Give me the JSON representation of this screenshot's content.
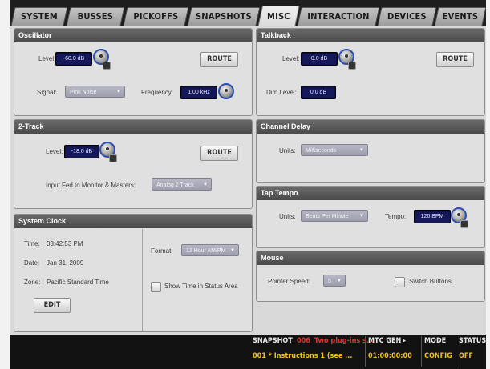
{
  "tabs": [
    {
      "label": "SYSTEM",
      "active": false
    },
    {
      "label": "BUSSES",
      "active": false
    },
    {
      "label": "PICKOFFS",
      "active": false
    },
    {
      "label": "SNAPSHOTS",
      "active": false
    },
    {
      "label": "MISC",
      "active": true
    },
    {
      "label": "INTERACTION",
      "active": false
    },
    {
      "label": "DEVICES",
      "active": false
    },
    {
      "label": "EVENTS",
      "active": false
    }
  ],
  "oscillator": {
    "title": "Oscillator",
    "level_label": "Level:",
    "level_value": "-60.0 dB",
    "route_label": "ROUTE",
    "signal_label": "Signal:",
    "signal_value": "Pink Noise",
    "frequency_label": "Frequency:",
    "frequency_value": "1.00 kHz"
  },
  "talkback": {
    "title": "Talkback",
    "level_label": "Level:",
    "level_value": "0.0 dB",
    "route_label": "ROUTE",
    "dim_label": "Dim Level:",
    "dim_value": "0.0 dB"
  },
  "two_track": {
    "title": "2-Track",
    "level_label": "Level:",
    "level_value": "-18.0 dB",
    "route_label": "ROUTE",
    "input_fed_label": "Input Fed to Monitor & Masters:",
    "input_fed_value": "Analog 2 Track"
  },
  "channel_delay": {
    "title": "Channel Delay",
    "units_label": "Units:",
    "units_value": "Milliseconds"
  },
  "tap_tempo": {
    "title": "Tap Tempo",
    "units_label": "Units:",
    "units_value": "Beats Per Minute",
    "tempo_label": "Tempo:",
    "tempo_value": "126 BPM"
  },
  "system_clock": {
    "title": "System Clock",
    "time_label": "Time:",
    "time_value": "03:42:53 PM",
    "date_label": "Date:",
    "date_value": "Jan 31, 2009",
    "zone_label": "Zone:",
    "zone_value": "Pacific Standard Time",
    "edit_label": "EDIT",
    "format_label": "Format:",
    "format_value": "12 Hour AM/PM",
    "show_time_label": "Show Time in Status Area"
  },
  "mouse": {
    "title": "Mouse",
    "pointer_speed_label": "Pointer Speed:",
    "pointer_speed_value": "5",
    "switch_buttons_label": "Switch Buttons"
  },
  "status": {
    "snapshot_label": "SNAPSHOT",
    "snapshot_num": "006",
    "snapshot_name": "Two plug-ins s...",
    "snapshot_line2": "001 * Instructions 1 (see ...",
    "mtc_label": "MTC GEN",
    "mtc_value": "01:00:00:00",
    "mode_label": "MODE",
    "mode_value": "CONFIG",
    "status_label": "STATUS",
    "status_value": "OFF",
    "colors": {
      "red": "#e0352a",
      "yellow": "#f2c318",
      "white": "#e8e8e8"
    }
  }
}
